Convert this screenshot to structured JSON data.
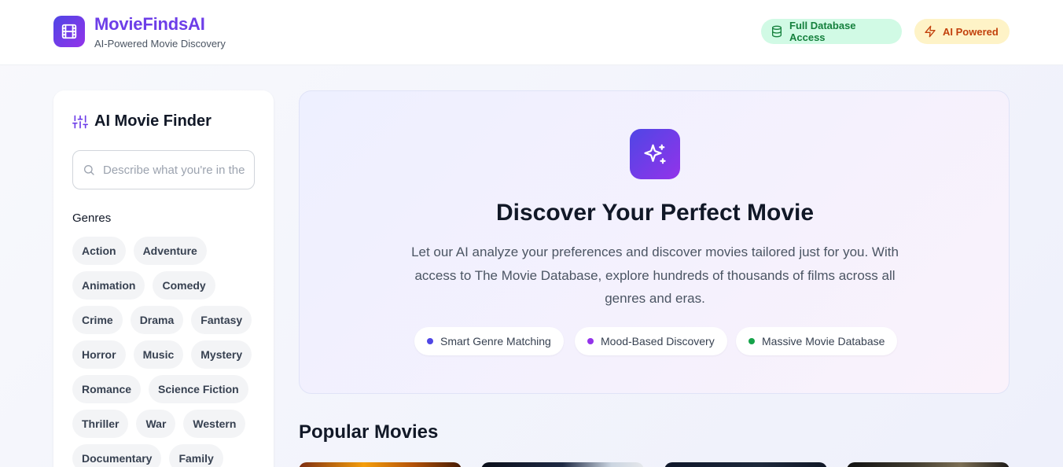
{
  "header": {
    "brand_name": "MovieFindsAI",
    "tagline": "AI-Powered Movie Discovery",
    "logo_icon": "film-icon",
    "badges": [
      {
        "label": "Full Database Access",
        "icon": "database-icon",
        "color": "#15803d"
      },
      {
        "label": "AI Powered",
        "icon": "zap-icon",
        "color": "#c2410c"
      }
    ]
  },
  "sidebar": {
    "title": "AI Movie Finder",
    "title_icon": "sliders-icon",
    "search": {
      "placeholder": "Describe what you're in the mood for...",
      "value": ""
    },
    "genres_label": "Genres",
    "genres": [
      "Action",
      "Adventure",
      "Animation",
      "Comedy",
      "Crime",
      "Drama",
      "Fantasy",
      "Horror",
      "Music",
      "Mystery",
      "Romance",
      "Science Fiction",
      "Thriller",
      "War",
      "Western",
      "Documentary",
      "Family"
    ]
  },
  "hero": {
    "icon": "sparkles-icon",
    "title": "Discover Your Perfect Movie",
    "description": "Let our AI analyze your preferences and discover movies tailored just for you. With access to The Movie Database, explore hundreds of thousands of films across all genres and eras.",
    "features": [
      {
        "label": "Smart Genre Matching",
        "dot_color": "#4f46e5"
      },
      {
        "label": "Mood-Based Discovery",
        "dot_color": "#9333ea"
      },
      {
        "label": "Massive Movie Database",
        "dot_color": "#16a34a"
      }
    ]
  },
  "popular": {
    "title": "Popular Movies"
  },
  "colors": {
    "brand": "#6d3ee8",
    "gradient_start": "#4f46e5",
    "gradient_end": "#9333ea"
  }
}
